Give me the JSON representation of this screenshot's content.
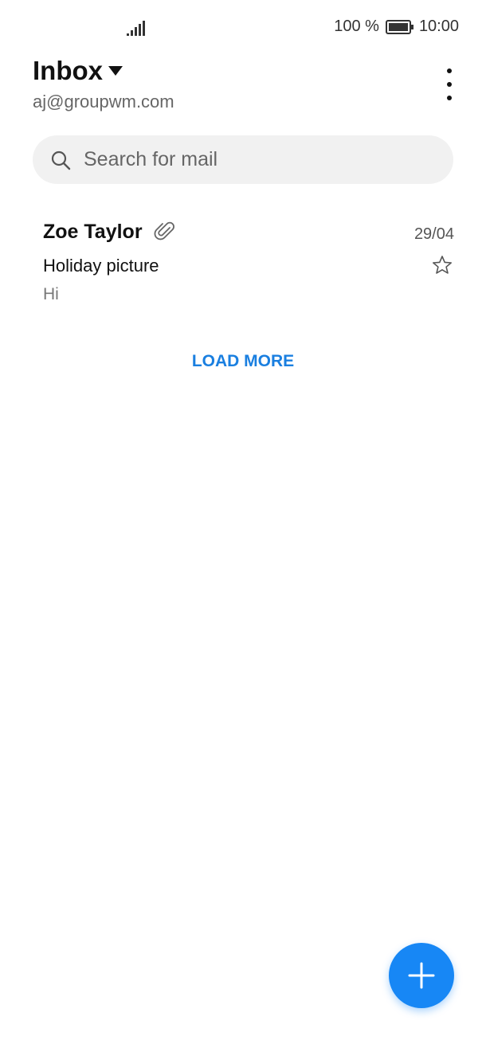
{
  "status_bar": {
    "battery_percent": "100 %",
    "time": "10:00",
    "icons": [
      "signal-icon",
      "battery-icon"
    ]
  },
  "header": {
    "title": "Inbox",
    "account": "aj@groupwm.com",
    "icons": [
      "dropdown-icon",
      "more-options-icon"
    ]
  },
  "search": {
    "placeholder": "Search for mail",
    "icon": "search-icon"
  },
  "mails": [
    {
      "sender": "Zoe Taylor",
      "date": "29/04",
      "subject": "Holiday picture",
      "preview": "Hi",
      "has_attachment": true,
      "starred": false
    }
  ],
  "load_more_label": "LOAD MORE",
  "fab": {
    "icon": "plus-icon"
  },
  "colors": {
    "accent": "#1787f5",
    "link": "#1a7fe0",
    "search_bg": "#f1f1f1"
  }
}
